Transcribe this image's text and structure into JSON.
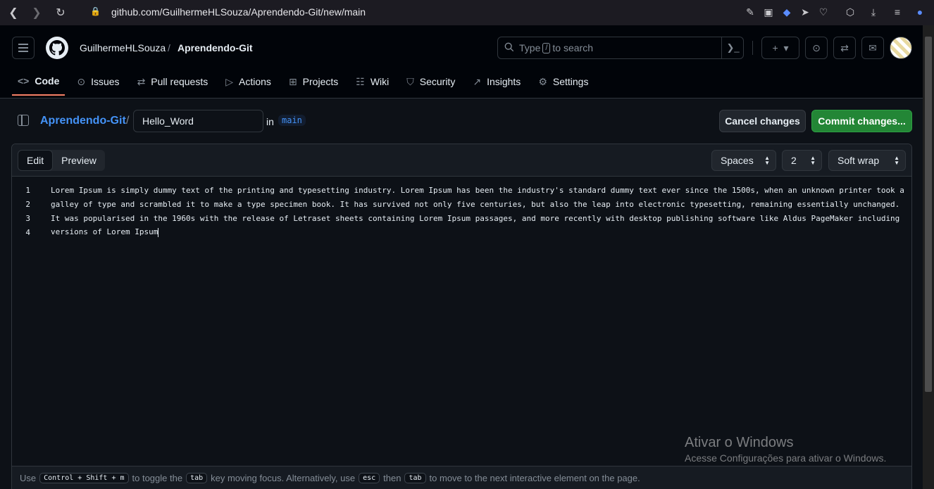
{
  "browser": {
    "url": "github.com/GuilhermeHLSouza/Aprendendo-Git/new/main"
  },
  "header": {
    "owner": "GuilhermeHLSouza",
    "separator": "/",
    "repo": "Aprendendo-Git",
    "search_prefix": "Type",
    "search_key": "/",
    "search_suffix": "to search"
  },
  "tabs": [
    {
      "label": "Code",
      "icon": "code-icon",
      "active": true
    },
    {
      "label": "Issues",
      "icon": "issue-opened-icon"
    },
    {
      "label": "Pull requests",
      "icon": "git-pull-request-icon"
    },
    {
      "label": "Actions",
      "icon": "play-icon"
    },
    {
      "label": "Projects",
      "icon": "table-icon"
    },
    {
      "label": "Wiki",
      "icon": "book-icon"
    },
    {
      "label": "Security",
      "icon": "shield-icon"
    },
    {
      "label": "Insights",
      "icon": "graph-icon"
    },
    {
      "label": "Settings",
      "icon": "gear-icon"
    }
  ],
  "file_bar": {
    "repo_link": "Aprendendo-Git",
    "slash": "/",
    "filename": "Hello_Word",
    "in_label": "in",
    "branch": "main",
    "cancel_label": "Cancel changes",
    "commit_label": "Commit changes..."
  },
  "editor": {
    "edit_label": "Edit",
    "preview_label": "Preview",
    "indent_mode": "Spaces",
    "indent_size": "2",
    "wrap_mode": "Soft wrap",
    "lines": [
      {
        "num": "1",
        "text": "Lorem Ipsum is simply dummy text of the printing and typesetting industry. Lorem Ipsum has been the industry's standard dummy text ever since the 1500s, when an unknown printer took a"
      },
      {
        "num": "2",
        "text": "galley of type and scrambled it to make a type specimen book. It has survived not only five centuries, but also the leap into electronic typesetting, remaining essentially unchanged."
      },
      {
        "num": "3",
        "text": "It was popularised in the 1960s with the release of Letraset sheets containing Lorem Ipsum passages, and more recently with desktop publishing software like Aldus PageMaker including"
      },
      {
        "num": "4",
        "text": "versions of Lorem Ipsum"
      }
    ]
  },
  "watermark": {
    "title": "Ativar o Windows",
    "subtitle": "Acesse Configurações para ativar o Windows."
  },
  "footer": {
    "t1": "Use",
    "k1": "Control + Shift + m",
    "t2": "to toggle the",
    "k2": "tab",
    "t3": "key moving focus. Alternatively, use",
    "k3": "esc",
    "t4": "then",
    "k4": "tab",
    "t5": "to move to the next interactive element on the page."
  },
  "colors": {
    "accent_link": "#4493f8",
    "commit_green": "#238636",
    "active_tab_underline": "#f78166"
  }
}
